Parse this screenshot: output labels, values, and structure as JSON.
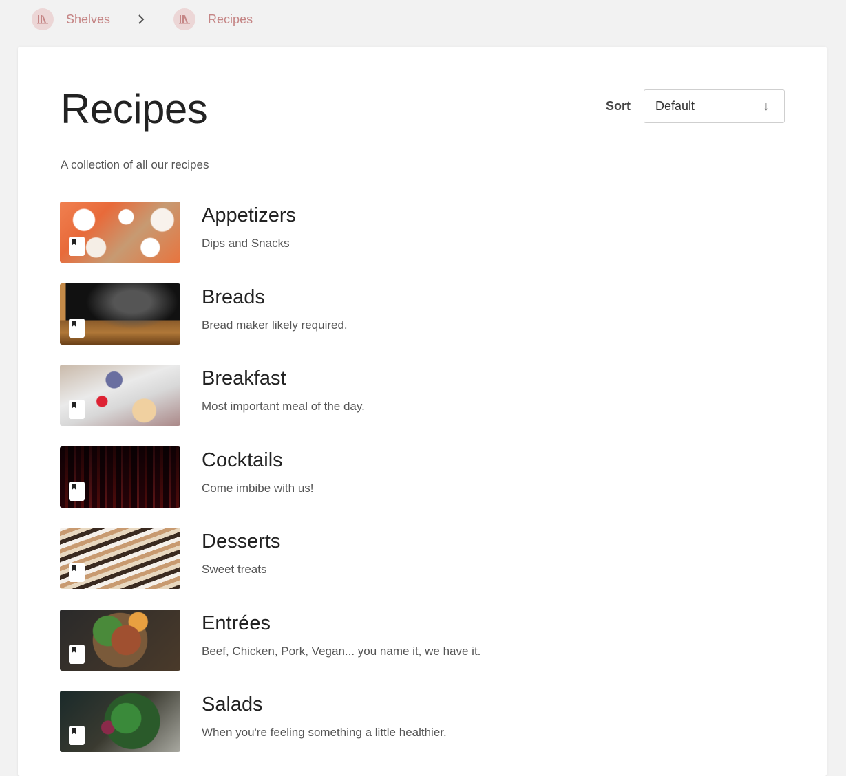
{
  "breadcrumbs": [
    {
      "label": "Shelves",
      "icon": "shelves-icon"
    },
    {
      "label": "Recipes",
      "icon": "shelf-icon"
    }
  ],
  "page": {
    "title": "Recipes",
    "description": "A collection of all our recipes"
  },
  "sort": {
    "label": "Sort",
    "selected": "Default",
    "direction": "↓"
  },
  "books": [
    {
      "name": "Appetizers",
      "description": "Dips and Snacks"
    },
    {
      "name": "Breads",
      "description": "Bread maker likely required."
    },
    {
      "name": "Breakfast",
      "description": "Most important meal of the day."
    },
    {
      "name": "Cocktails",
      "description": "Come imbibe with us!"
    },
    {
      "name": "Desserts",
      "description": "Sweet treats"
    },
    {
      "name": "Entrées",
      "description": "Beef, Chicken, Pork, Vegan... you name it, we have it."
    },
    {
      "name": "Salads",
      "description": "When you're feeling something a little healthier."
    }
  ],
  "colors": {
    "accent": "#c58585",
    "background": "#f2f2f2"
  }
}
